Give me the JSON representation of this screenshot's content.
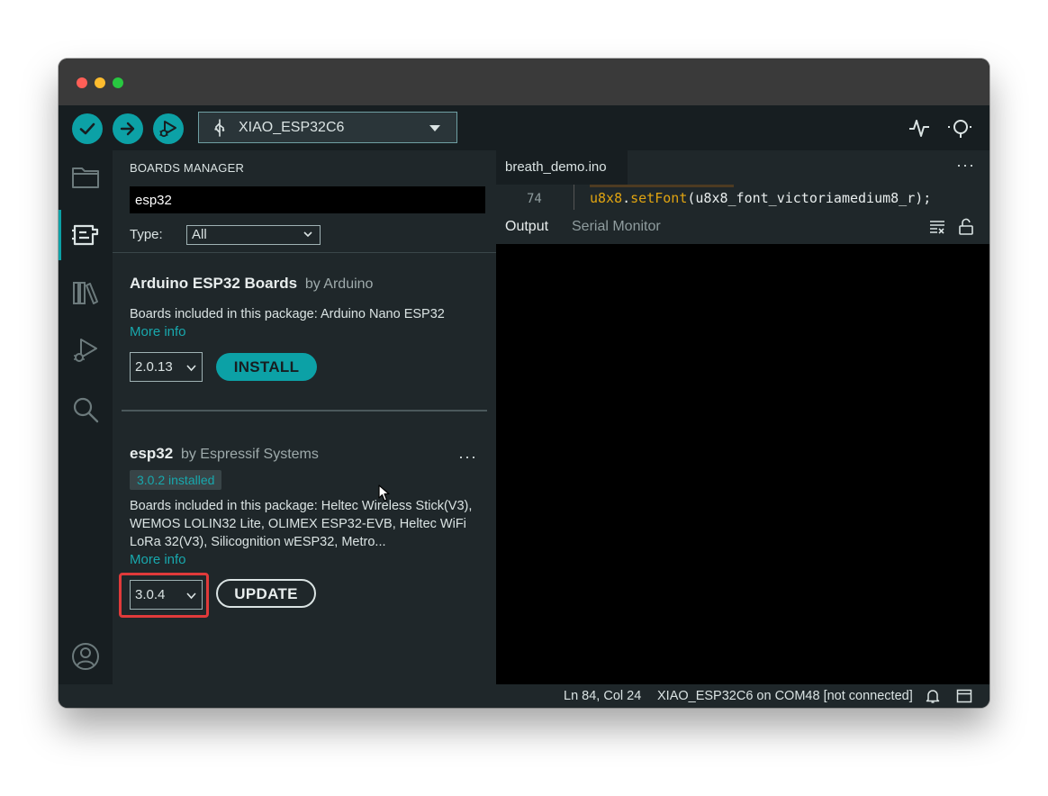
{
  "toolbar": {
    "board_name": "XIAO_ESP32C6",
    "verify_icon": "check-icon",
    "upload_icon": "arrow-right-icon",
    "debug_icon": "debug-icon",
    "serial_plotter_icon": "pulse-icon",
    "serial_monitor_icon": "magnifier-icon"
  },
  "sidebar": {
    "items": [
      {
        "name": "sketchbook",
        "icon": "folder-icon"
      },
      {
        "name": "boards-manager",
        "icon": "board-icon",
        "active": true
      },
      {
        "name": "library-manager",
        "icon": "books-icon"
      },
      {
        "name": "debug",
        "icon": "debug-icon"
      },
      {
        "name": "search",
        "icon": "search-icon"
      }
    ],
    "profile_icon": "user-icon"
  },
  "boards_manager": {
    "title": "BOARDS MANAGER",
    "search_value": "esp32",
    "type_label": "Type:",
    "type_value": "All",
    "packages": [
      {
        "name": "Arduino ESP32 Boards",
        "by": "by Arduino",
        "description": "Boards included in this package: Arduino Nano ESP32",
        "more_info": "More info",
        "version": "2.0.13",
        "action": "INSTALL"
      },
      {
        "name": "esp32",
        "by": "by Espressif Systems",
        "installed_badge": "3.0.2 installed",
        "description": "Boards included in this package: Heltec Wireless Stick(V3), WEMOS LOLIN32 Lite, OLIMEX ESP32-EVB, Heltec WiFi LoRa 32(V3), Silicognition wESP32, Metro...",
        "more_info": "More info",
        "version": "3.0.4",
        "action": "UPDATE",
        "more_menu": "···"
      }
    ]
  },
  "editor": {
    "tab": "breath_demo.ino",
    "tab_menu": "···",
    "line_number": "74",
    "code_obj": "u8x8",
    "code_dot": ".",
    "code_fn": "setFont",
    "code_args": "(u8x8_font_victoriamedium8_r);",
    "output_tabs": [
      "Output",
      "Serial Monitor"
    ]
  },
  "statusbar": {
    "position": "Ln 84, Col 24",
    "board": "XIAO_ESP32C6 on COM48 [not connected]"
  },
  "colors": {
    "accent": "#0ca1a6",
    "highlight": "#e03a3a",
    "background": "#171e21"
  }
}
